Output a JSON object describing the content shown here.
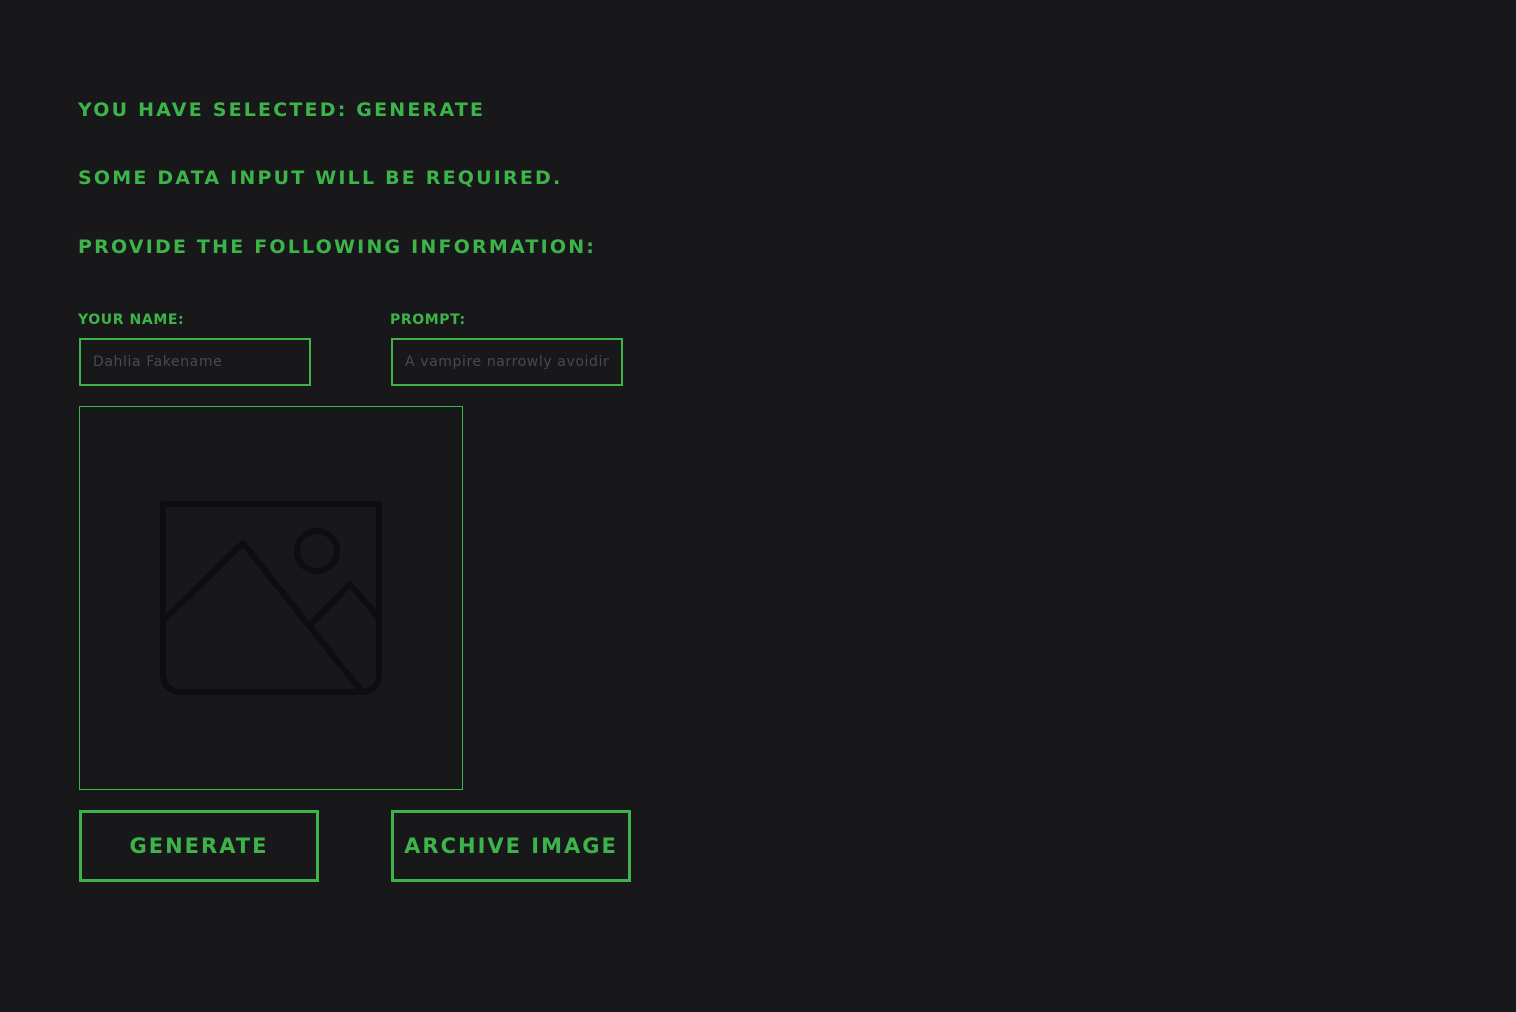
{
  "intro": {
    "selected_text": "YOU HAVE SELECTED: GENERATE",
    "data_text": "SOME DATA INPUT WILL BE REQUIRED.",
    "provide_text": "PROVIDE THE FOLLOWING INFORMATION:"
  },
  "form": {
    "name_label": "YOUR NAME:",
    "name_placeholder": "Dahlia Fakename",
    "prompt_label": "PROMPT:",
    "prompt_placeholder": "A vampire narrowly avoiding"
  },
  "image": {
    "icon": "image-placeholder-icon"
  },
  "buttons": {
    "generate_label": "GENERATE",
    "archive_label": "ARCHIVE IMAGE"
  },
  "colors": {
    "background": "#18181a",
    "accent": "#3cb44a",
    "placeholder_text": "#4a4a4e"
  }
}
